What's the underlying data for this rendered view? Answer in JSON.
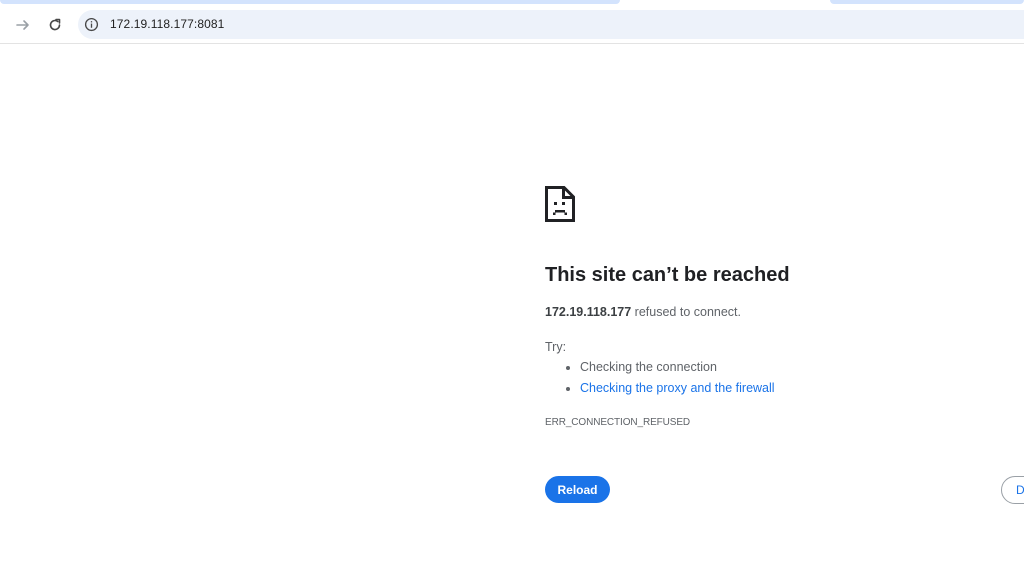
{
  "browser": {
    "url": "172.19.118.177:8081",
    "back_icon": "arrow-right-icon",
    "reload_icon": "reload-icon",
    "site_info_icon": "info-icon"
  },
  "error": {
    "icon": "sad-page-icon",
    "title": "This site can’t be reached",
    "host": "172.19.118.177",
    "message": " refused to connect.",
    "try_label": "Try:",
    "suggestions": [
      "Checking the connection",
      "Checking the proxy and the firewall"
    ],
    "code": "ERR_CONNECTION_REFUSED",
    "reload_label": "Reload",
    "details_label": "D"
  },
  "colors": {
    "accent": "#1a73e8",
    "omnibox_bg": "#edf2fa"
  }
}
